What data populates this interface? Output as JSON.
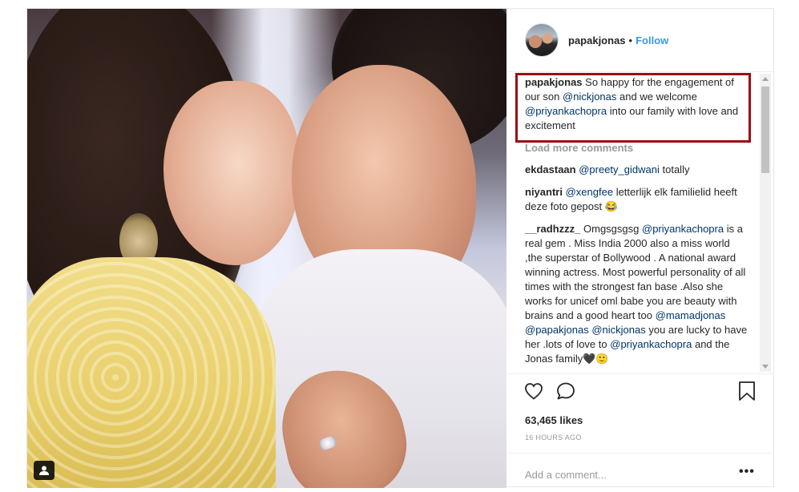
{
  "post": {
    "username": "papakjonas",
    "separator": "•",
    "follow_label": "Follow",
    "caption": {
      "user": "papakjonas",
      "text_1": "So happy for the engagement of our son",
      "mention_1": "@nickjonas",
      "text_2": "and we welcome",
      "mention_2": "@priyankachopra",
      "text_3": "into our family with love and excitement"
    },
    "load_more_label": "Load more comments",
    "comments": [
      {
        "user": "ekdastaan",
        "mention": "@preety_gidwani",
        "text": "totally"
      },
      {
        "user": "niyantri",
        "mention": "@xengfee",
        "text": "letterlijk elk familielid heeft deze foto gepost 😂"
      },
      {
        "user": "__radhzzz_",
        "t1": "Omgsgsgsg",
        "m1": "@priyankachopra",
        "t2": "is a real gem . Miss India 2000 also a miss world ,the superstar of Bollywood . A national award winning actress. Most powerful personality of all times with the strongest fan base .Also she works for unicef oml babe you are beauty with brains and a good heart too",
        "m2": "@mamadjonas",
        "m3": "@papakjonas",
        "m4": "@nickjonas",
        "t3": "you are lucky to have her .lots of love to",
        "m5": "@priyankachopra",
        "t4": "and the Jonas family🖤🙂"
      }
    ],
    "likes": "63,465 likes",
    "time": "16 HOURS AGO",
    "add_comment_placeholder": "Add a comment...",
    "more_options": "•••"
  },
  "icons": [
    "heart-icon",
    "comment-icon",
    "bookmark-icon",
    "user-tag-icon",
    "more-options-icon"
  ],
  "colors": {
    "follow": "#3897f0",
    "mention": "#003569",
    "highlight": "#9b0c16",
    "muted": "#999999"
  }
}
